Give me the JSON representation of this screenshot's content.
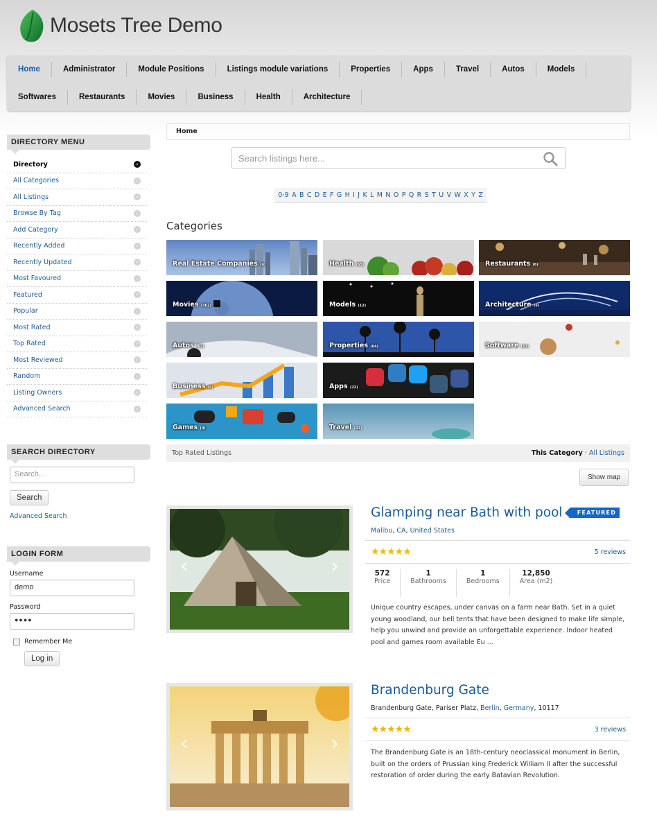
{
  "site": {
    "title": "Mosets Tree Demo"
  },
  "nav": {
    "row1": [
      "Home",
      "Administrator",
      "Module Positions",
      "Listings module variations",
      "Properties",
      "Apps",
      "Travel",
      "Autos",
      "Models"
    ],
    "row2": [
      "Softwares",
      "Restaurants",
      "Movies",
      "Business",
      "Health",
      "Architecture"
    ]
  },
  "directory_menu": {
    "title": "DIRECTORY MENU",
    "items": [
      "Directory",
      "All Categories",
      "All Listings",
      "Browse By Tag",
      "Add Category",
      "Recently Added",
      "Recently Updated",
      "Most Favoured",
      "Featured",
      "Popular",
      "Most Rated",
      "Top Rated",
      "Most Reviewed",
      "Random",
      "Listing Owners",
      "Advanced Search"
    ]
  },
  "search_directory": {
    "title": "SEARCH DIRECTORY",
    "placeholder": "Search...",
    "button": "Search",
    "advanced": "Advanced Search"
  },
  "login": {
    "title": "LOGIN FORM",
    "username_label": "Username",
    "username_value": "demo",
    "password_label": "Password",
    "password_value": "●●●●",
    "remember": "Remember Me",
    "button": "Log in"
  },
  "breadcrumb": "Home",
  "main_search": {
    "placeholder": "Search listings here..."
  },
  "alphabet": [
    "0-9",
    "A",
    "B",
    "C",
    "D",
    "E",
    "F",
    "G",
    "H",
    "I",
    "J",
    "K",
    "L",
    "M",
    "N",
    "O",
    "P",
    "Q",
    "R",
    "S",
    "T",
    "U",
    "V",
    "W",
    "X",
    "Y",
    "Z"
  ],
  "categories": {
    "heading": "Categories",
    "items": [
      {
        "name": "Real Estate Companies",
        "count": "(6)"
      },
      {
        "name": "Health",
        "count": "(65)"
      },
      {
        "name": "Restaurants",
        "count": "(6)"
      },
      {
        "name": "Movies",
        "count": "(362)"
      },
      {
        "name": "Models",
        "count": "(12)"
      },
      {
        "name": "Architecture",
        "count": "(6)"
      },
      {
        "name": "Autos",
        "count": "(62)"
      },
      {
        "name": "Properties",
        "count": "(64)"
      },
      {
        "name": "Software",
        "count": "(11)"
      },
      {
        "name": "Business",
        "count": "(6)"
      },
      {
        "name": "Apps",
        "count": "(22)"
      },
      {
        "name": "Games",
        "count": "(9)"
      },
      {
        "name": "Travel",
        "count": "(42)"
      }
    ]
  },
  "top_rated": {
    "label": "Top Rated Listings",
    "this_category": "This Category",
    "separator": "·",
    "all_listings": "All Listings"
  },
  "show_map": "Show map",
  "listings": [
    {
      "title": "Glamping near Bath with pool",
      "badge": "FEATURED",
      "address": {
        "city": "Malibu",
        "state": "CA",
        "country": "United States"
      },
      "rating": 5,
      "reviews": "5 reviews",
      "stats": [
        {
          "value": "572",
          "label": "Price"
        },
        {
          "value": "1",
          "label": "Bathrooms"
        },
        {
          "value": "1",
          "label": "Bedrooms"
        },
        {
          "value": "12,850",
          "label": "Area (m2)"
        }
      ],
      "description": "Unique country escapes, under canvas on a farm near Bath. Set in a quiet young woodland, our bell tents that have been designed to make life simple, help you unwind and provide an unforgettable experience. Indoor heated pool and games room available Eu ..."
    },
    {
      "title": "Brandenburg Gate",
      "address": {
        "street": "Brandenburg Gate, Pariser Platz,",
        "city": "Berlin",
        "country": "Germany",
        "zip": "10117"
      },
      "rating": 5,
      "reviews": "3 reviews",
      "description": "The Brandenburg Gate is an 18th-century neoclassical monument in Berlin, built on the orders of Prussian king Frederick William II after the successful restoration of order during the early Batavian Revolution."
    }
  ],
  "colors": {
    "link": "#1e5b96",
    "featured": "#1566c9",
    "star": "#f2b60f",
    "logo": "#1f8a3b"
  }
}
